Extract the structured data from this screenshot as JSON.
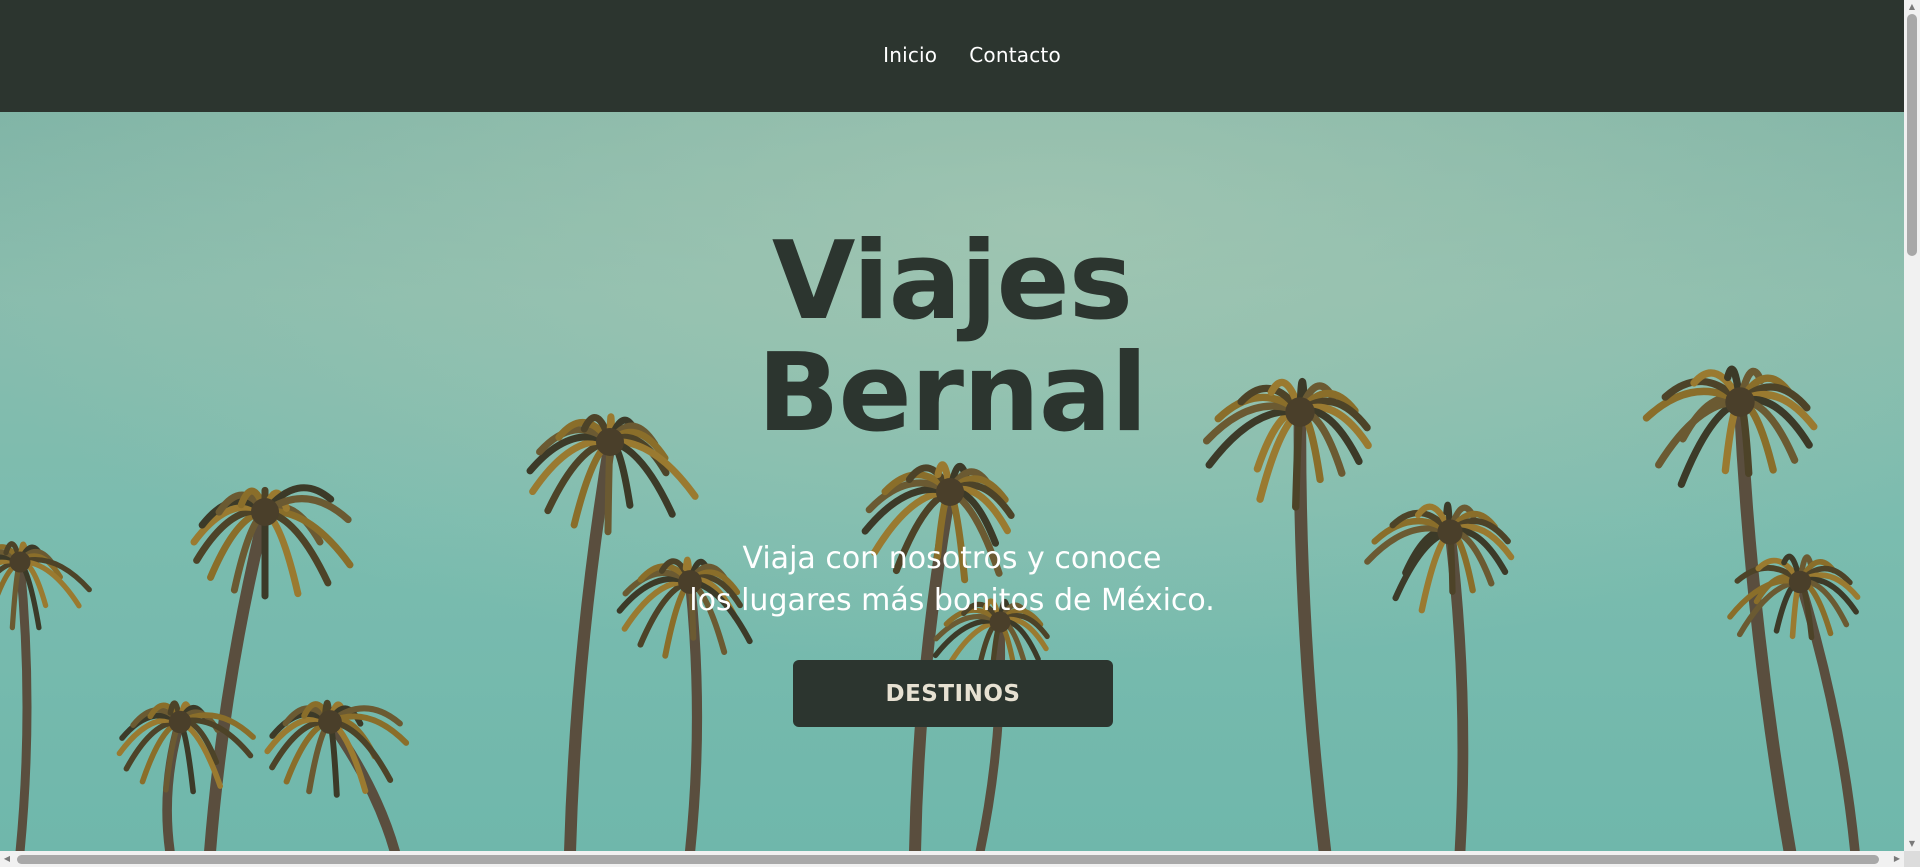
{
  "nav": {
    "links": [
      {
        "label": "Inicio"
      },
      {
        "label": "Contacto"
      }
    ]
  },
  "hero": {
    "title_line1": "Viajes",
    "title_line2": "Bernal",
    "subtitle_line1": "Viaja con nosotros y conoce",
    "subtitle_line2": "los lugares más bonitos de México.",
    "button_label": "DESTINOS",
    "background_image": "palm-trees-sky"
  },
  "colors": {
    "nav_bg": "#2c352f",
    "title": "#2c352f",
    "button_bg": "#2c352f",
    "button_text": "#e7e1d2",
    "sky": "#7fb4a6"
  },
  "scrollbars": {
    "up_icon": "▲",
    "down_icon": "▼",
    "left_icon": "◀",
    "right_icon": "▶"
  }
}
